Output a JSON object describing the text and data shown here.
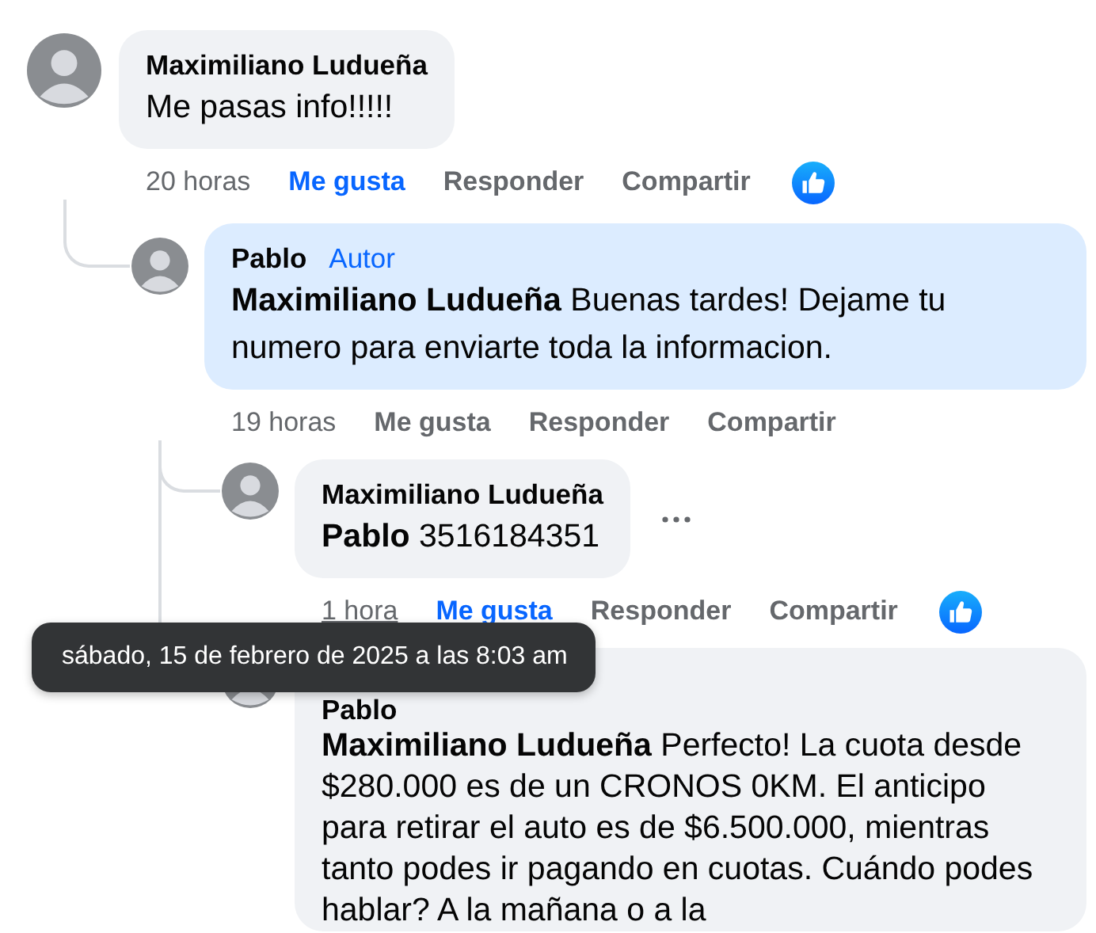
{
  "comments": [
    {
      "author": "Maximiliano Ludueña",
      "text": "Me pasas info!!!!!",
      "highlighted": false,
      "time": {
        "text": "20 horas",
        "underlined": false
      },
      "actions": [
        "Me gusta",
        "Responder",
        "Compartir"
      ],
      "liked": true,
      "reaction": true,
      "more": false,
      "replies": [
        {
          "author": "Pablo",
          "badge": "Autor",
          "text": "**Maximiliano Ludueña** Buenas tardes! Dejame tu numero para enviarte toda la informacion.",
          "highlighted": true,
          "time": {
            "text": "19 horas",
            "underlined": false
          },
          "actions": [
            "Me gusta",
            "Responder",
            "Compartir"
          ],
          "liked": false,
          "reaction": false,
          "more": false,
          "replies": [
            {
              "author": "Maximiliano Ludueña",
              "text": "**Pablo** 3516184351",
              "highlighted": false,
              "time": {
                "text": "1 hora",
                "underlined": true
              },
              "actions": [
                "Me gusta",
                "Responder",
                "Compartir"
              ],
              "liked": true,
              "reaction": true,
              "more": true
            },
            {
              "author": "Pablo",
              "text": "**Maximiliano Ludueña** Perfecto! La cuota desde $280.000 es de un CRONOS 0KM. El anticipo para retirar el auto es de $6.500.000, mientras tanto podes ir pagando en cuotas. Cuándo podes hablar? A la mañana o a la",
              "highlighted": false
            }
          ]
        }
      ]
    }
  ],
  "tooltip": {
    "text": "sábado, 15 de febrero de 2025 a las 8:03 am"
  }
}
